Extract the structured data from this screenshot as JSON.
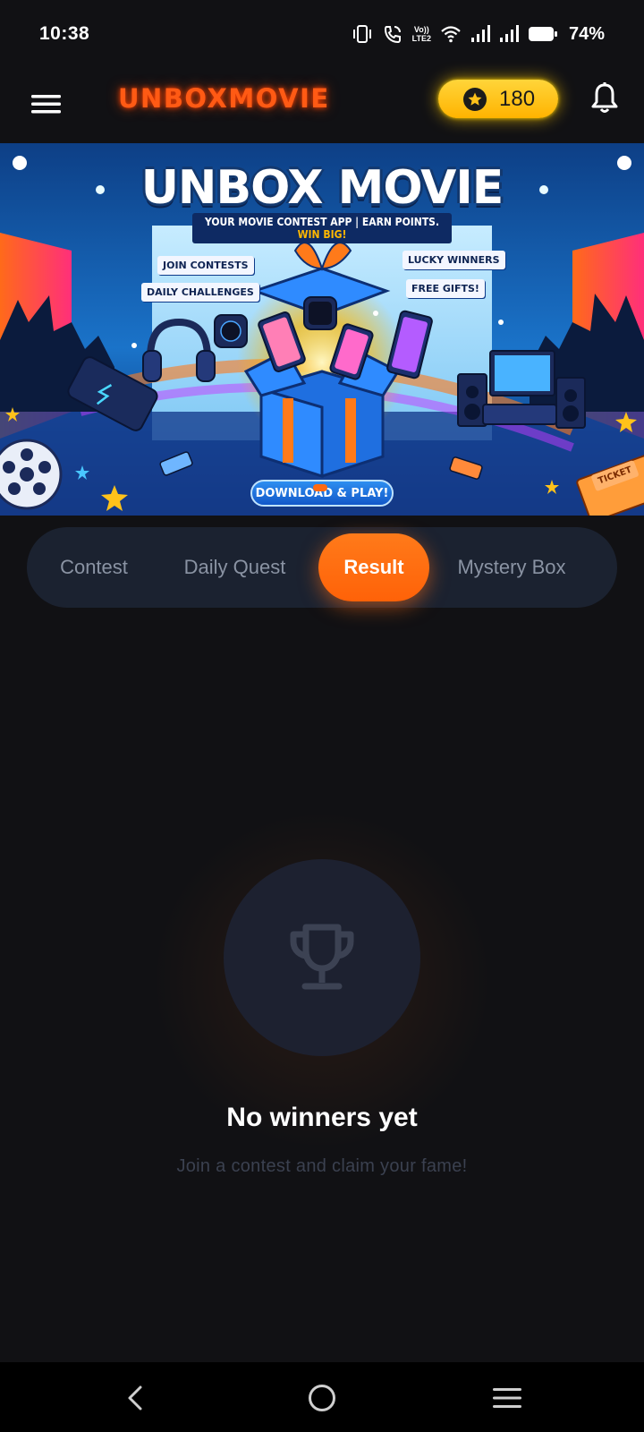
{
  "status_bar": {
    "time": "10:38",
    "volte_top": "Vo))",
    "volte_bottom": "LTE2",
    "battery": "74%"
  },
  "header": {
    "brand": "UNBOXMOVIE",
    "coins": "180",
    "coin_icon": "star-coin-icon",
    "accent_color": "#ff5a14",
    "coin_color": "#ffc21a"
  },
  "banner": {
    "title": "UNBOX MOVIE",
    "subtitle_main": "YOUR MOVIE CONTEST APP | EARN POINTS. ",
    "subtitle_highlight": "WIN BIG!",
    "tag_join": "JOIN CONTESTS",
    "tag_daily": "DAILY CHALLENGES",
    "tag_lucky": "LUCKY WINNERS",
    "tag_gifts": "FREE GIFTS!",
    "cta": "DOWNLOAD & PLAY!",
    "ticket": "TICKET"
  },
  "tabs": [
    {
      "label": "Contest",
      "active": false
    },
    {
      "label": "Daily Quest",
      "active": false
    },
    {
      "label": "Result",
      "active": true
    },
    {
      "label": "Mystery Box",
      "active": false
    }
  ],
  "empty_state": {
    "icon": "trophy-icon",
    "title": "No winners yet",
    "subtitle": "Join a contest and claim your fame!"
  }
}
